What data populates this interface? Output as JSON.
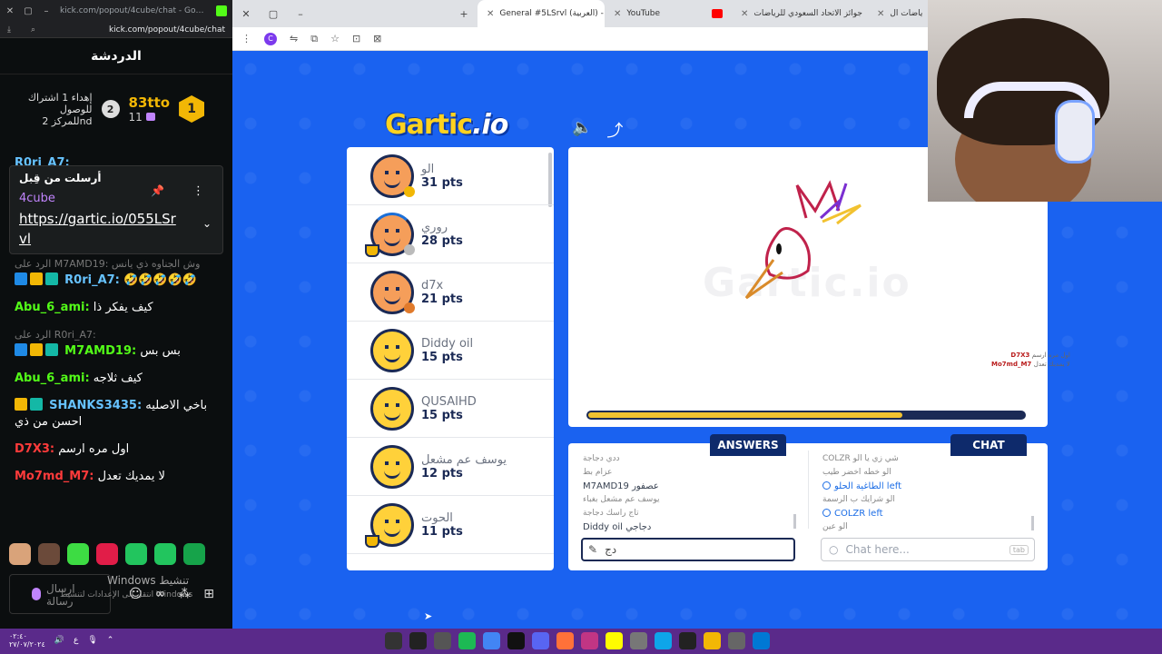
{
  "kick": {
    "window_title": "kick.com/popout/4cube/chat - Google Chro...",
    "url": "kick.com/popout/4cube/chat",
    "header_title": "الدردشة",
    "leaderboard": {
      "first_rank": "1",
      "first_user": "83tto",
      "first_count": "11",
      "second_rank": "2",
      "goal_line1": "إهداء 1 اشتراك",
      "goal_line2": "للوصول",
      "goal_line3": "للمركز 2nd"
    },
    "top_strip_user": "R0ri_A7:",
    "pinned": {
      "label": "أرسلت من قِبل",
      "user": "4cube",
      "link": "https://gartic.io/055LSrvl"
    },
    "messages": [
      {
        "reply": "الرد على M7AMD19: وش الجناوه ذي يانس",
        "user": "R0ri_A7:",
        "text": "🤣🤣🤣🤣🤣"
      },
      {
        "reply": "",
        "user": "Abu_6_ami:",
        "text": "كيف يفكر ذا"
      },
      {
        "reply": "الرد على R0ri_A7:",
        "user": "M7AMD19:",
        "text": "بس بس"
      },
      {
        "reply": "",
        "user": "Abu_6_ami:",
        "text": "كيف ثلاجه"
      },
      {
        "reply": "",
        "user": "SHANKS3435:",
        "text": "باخي الاصليه احسن من ذي"
      },
      {
        "reply": "",
        "user": "D7X3:",
        "text": "اول مره ارسم"
      },
      {
        "reply": "",
        "user": "Mo7md_M7:",
        "text": "لا يمديك تعدل"
      }
    ],
    "input_placeholder": "ارسال رسالة",
    "windows_activate": "Windows تنشيط",
    "windows_activate_sub": "انتقل إلى الإعدادات لتنشيط Windows"
  },
  "browser": {
    "tabs": [
      {
        "label": "General #5LSrvl (العربية) - Gartic",
        "fav_color": "#1462f5",
        "active": true
      },
      {
        "label": "YouTube",
        "fav_color": "#ff0000",
        "active": false
      },
      {
        "label": "جوائز الاتحاد السعودي للرياضات",
        "fav_color": "#f2b705",
        "active": false
      },
      {
        "label": "للرياضات ال",
        "fav_color": "#f2b705",
        "active": false
      }
    ],
    "new_tab": "+",
    "toolbar_badge": "C"
  },
  "gartic": {
    "logo_main": "Gartic",
    "logo_io": ".io",
    "players": [
      {
        "name": "الو",
        "points": "31 pts",
        "avatar": "orange",
        "dot": "#f2b705",
        "trophy": false
      },
      {
        "name": "روري",
        "points": "28 pts",
        "avatar": "blue",
        "dot": "#bbbbbb",
        "trophy": true
      },
      {
        "name": "d7x",
        "points": "21 pts",
        "avatar": "orange",
        "dot": "#e07a2b",
        "trophy": false
      },
      {
        "name": "Diddy oil",
        "points": "15 pts",
        "avatar": "yellow",
        "dot": "",
        "trophy": false
      },
      {
        "name": "QUSAIHD",
        "points": "15 pts",
        "avatar": "yellow",
        "dot": "",
        "trophy": false
      },
      {
        "name": "يوسف عم مشعل",
        "points": "12 pts",
        "avatar": "yellow",
        "dot": "",
        "trophy": false
      },
      {
        "name": "الحوت",
        "points": "11 pts",
        "avatar": "yellow",
        "dot": "",
        "trophy": true
      }
    ],
    "canvas_watermark": "Gartic.io",
    "timer_progress": 0.72,
    "overlay": {
      "line1": "D7X3",
      "line2": "Mo7md_M7",
      "sub1": "اول مره ارسم",
      "sub2": "لا يمديك تعدل"
    },
    "answers_tab": "ANSWERS",
    "chat_tab": "CHAT",
    "answers": [
      {
        "text": "ددي دجاجة",
        "strong": false
      },
      {
        "text": "عزام بط",
        "strong": false
      },
      {
        "text": "M7AMD19 عصفور",
        "strong": true
      },
      {
        "text": "يوسف عم مشعل بغباء",
        "strong": false
      },
      {
        "text": "تاج راسك دجاجة",
        "strong": false
      },
      {
        "text": "Diddy oil دجاجي",
        "strong": true
      }
    ],
    "chat": [
      {
        "text": "COLZR شي زي يا الو",
        "sys": false
      },
      {
        "text": "الو خطه اخضر طيب",
        "sys": false
      },
      {
        "text": "الطاغية الحلو left",
        "sys": true
      },
      {
        "text": "الو شرايك ب الرسمة",
        "sys": false
      },
      {
        "text": "COLZR left",
        "sys": true
      },
      {
        "text": "الو عين",
        "sys": false
      }
    ],
    "answer_input_value": "دج",
    "chat_placeholder": "Chat here...",
    "tab_key": "tab"
  },
  "taskbar": {
    "time": "٠٢:٤٠",
    "date": "٢٧/٠٧/٢٠٢٤",
    "lang": "ع"
  }
}
